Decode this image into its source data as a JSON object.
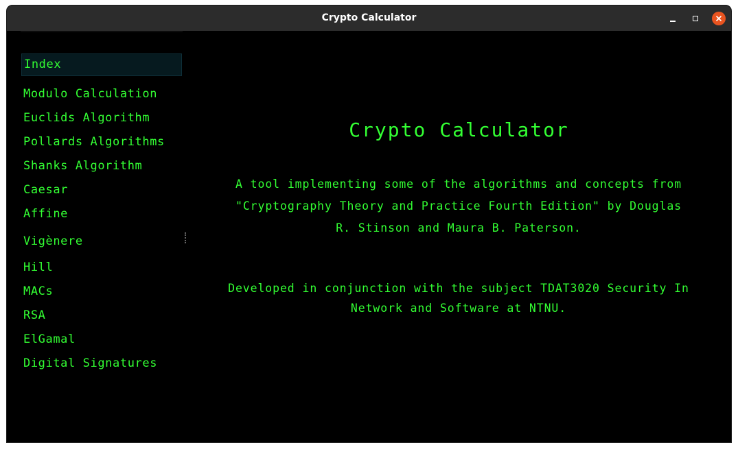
{
  "window": {
    "title": "Crypto Calculator",
    "close_color": "#e95420"
  },
  "sidebar": {
    "accent_color": "#33ff33",
    "selected_index": 0,
    "items": [
      {
        "label": "Index"
      },
      {
        "label": "Modulo Calculation"
      },
      {
        "label": "Euclids Algorithm"
      },
      {
        "label": "Pollards Algorithms"
      },
      {
        "label": "Shanks Algorithm"
      },
      {
        "label": "Caesar"
      },
      {
        "label": "Affine"
      },
      {
        "label": "Vigènere"
      },
      {
        "label": "Hill"
      },
      {
        "label": "MACs"
      },
      {
        "label": "RSA"
      },
      {
        "label": "ElGamal"
      },
      {
        "label": "Digital Signatures"
      }
    ]
  },
  "main": {
    "heading": "Crypto Calculator",
    "description_line1": "A tool implementing some of the algorithms and concepts from",
    "description_line2": "\"Cryptography Theory and Practice Fourth Edition\" by Douglas",
    "description_line3": "R. Stinson and Maura B. Paterson.",
    "credits_line1": "Developed in conjunction with the subject TDAT3020 Security In",
    "credits_line2": "Network and Software at NTNU."
  }
}
